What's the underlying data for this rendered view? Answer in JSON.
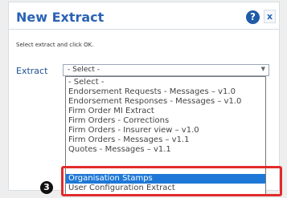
{
  "dialog": {
    "title": "New Extract",
    "help_icon": "?",
    "close_icon": "x",
    "instruction": "Select extract and click OK."
  },
  "form": {
    "extract_label": "Extract",
    "selected_value": "- Select -",
    "dropdown_icon": "▼"
  },
  "options": [
    "- Select -",
    "Endorsement Requests - Messages – v1.0",
    "Endorsement Responses - Messages – v1.0",
    "Firm Order MI Extract",
    "Firm Orders - Corrections",
    "Firm Orders - Insurer view – v1.0",
    "Firm Orders - Messages – v1.1",
    "Quotes - Messages – v1.1",
    "Organisation Stamps",
    "User Configuration Extract"
  ],
  "callout": {
    "number": "3"
  },
  "colors": {
    "accent": "#2b63b4",
    "selected": "#1e78d7",
    "highlight": "#e22b2b"
  }
}
